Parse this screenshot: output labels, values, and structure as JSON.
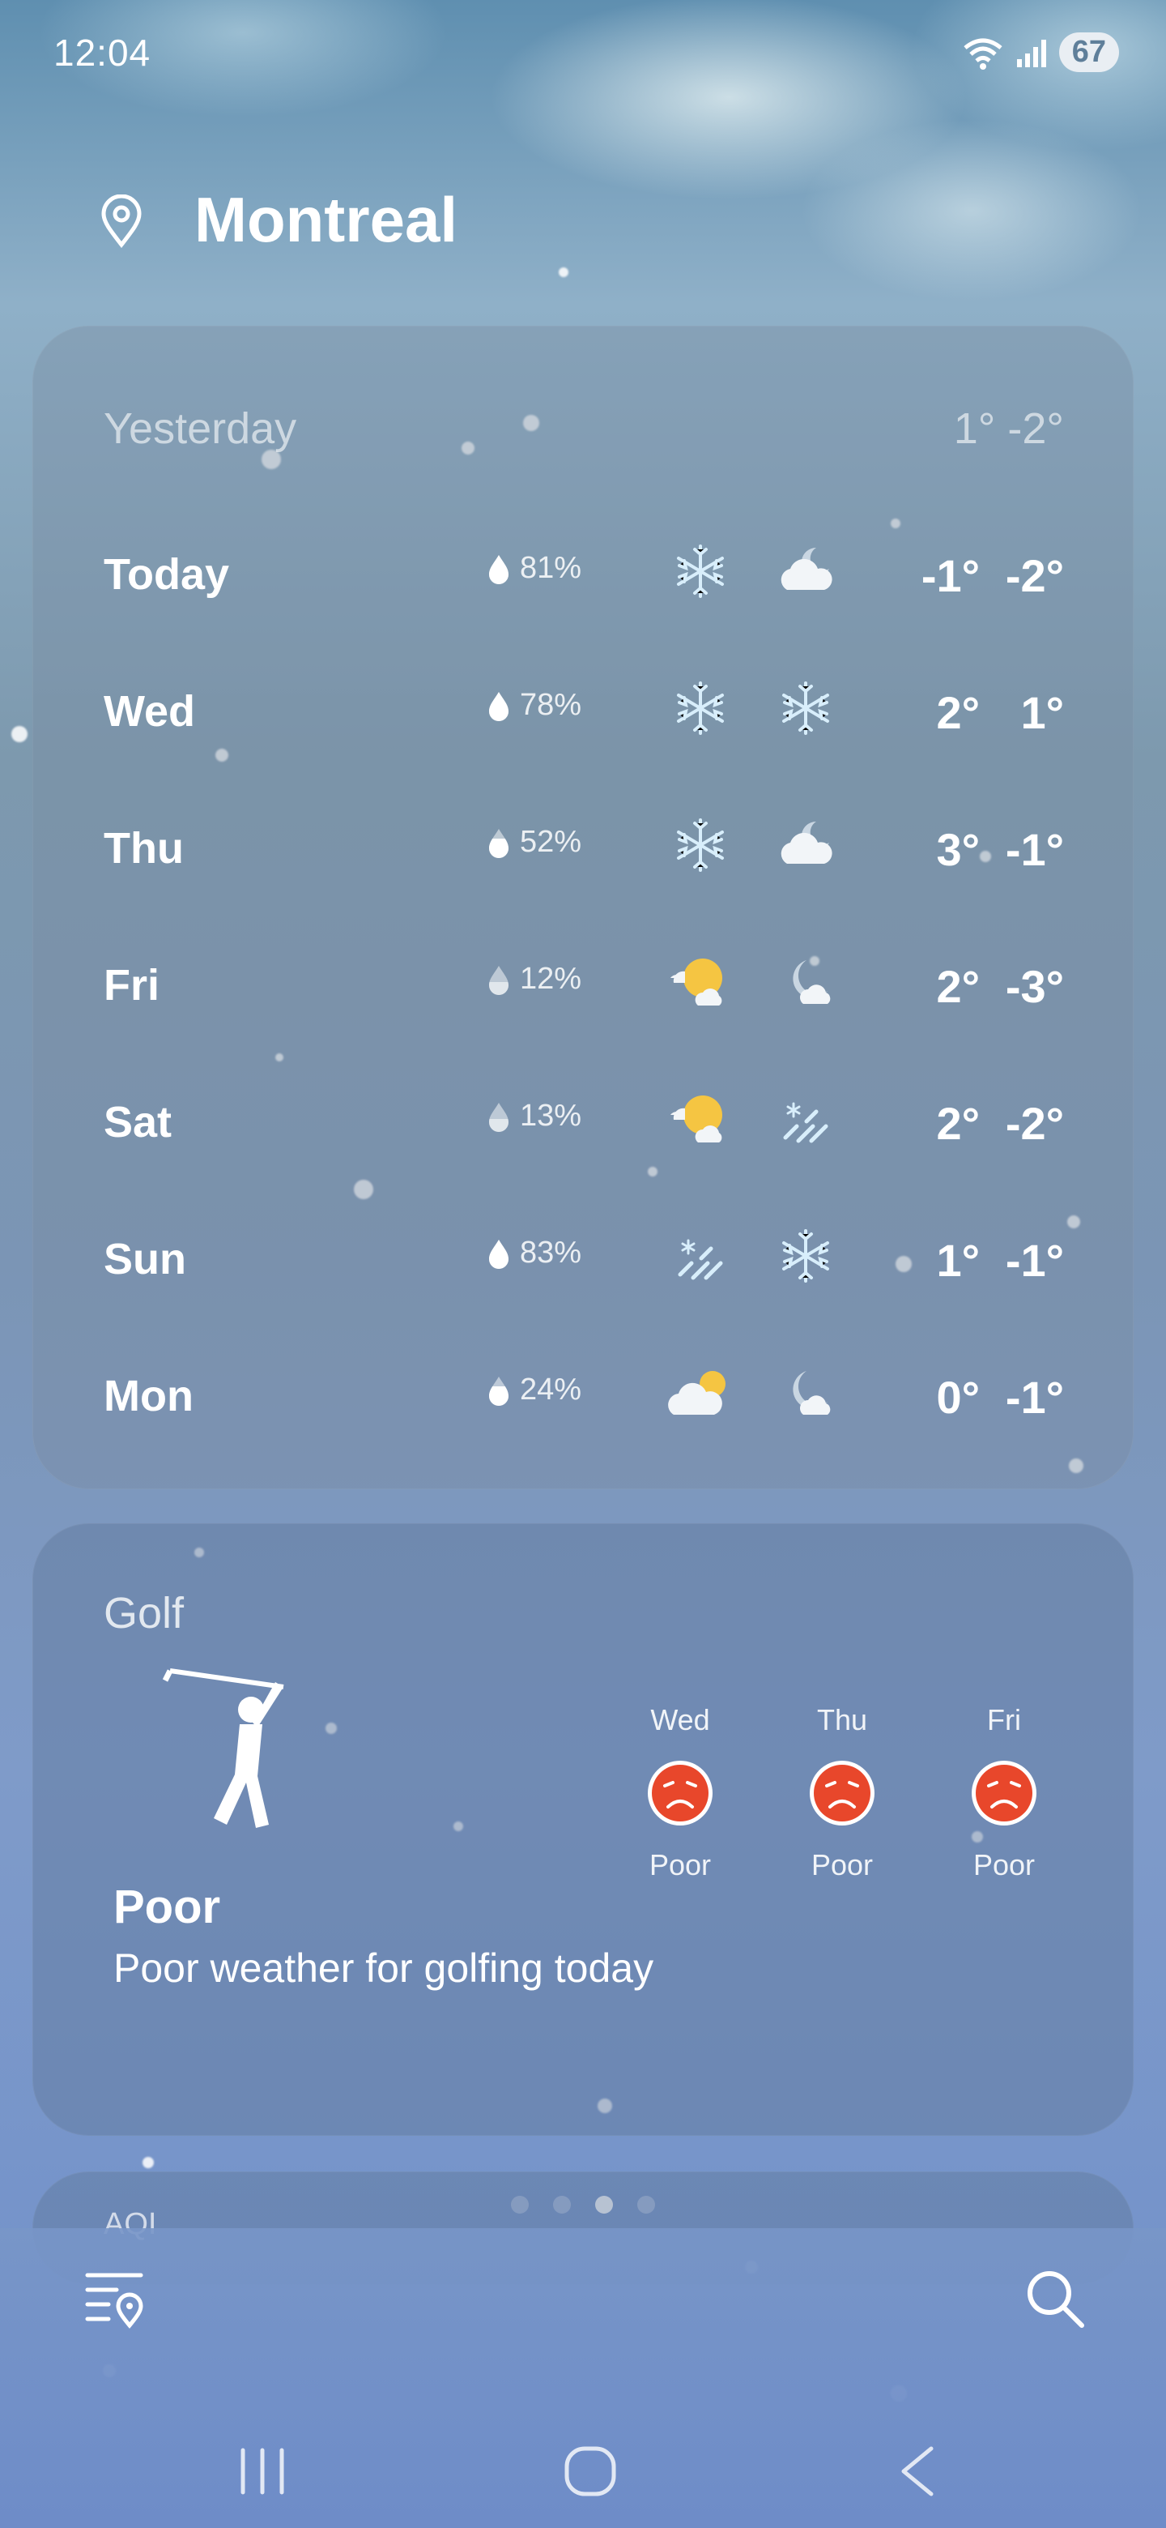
{
  "status_bar": {
    "time": "12:04",
    "battery": "67"
  },
  "header": {
    "city": "Montreal"
  },
  "forecast": {
    "yesterday": {
      "label": "Yesterday",
      "temps": "1° -2°"
    },
    "days": [
      {
        "day": "Today",
        "precip": "81%",
        "day_icon": "snowflake",
        "night_icon": "cloud-moon",
        "hi": "-1°",
        "lo": "-2°"
      },
      {
        "day": "Wed",
        "precip": "78%",
        "day_icon": "snowflake",
        "night_icon": "snowflake",
        "hi": "2°",
        "lo": "1°"
      },
      {
        "day": "Thu",
        "precip": "52%",
        "day_icon": "snowflake",
        "night_icon": "cloud-moon",
        "hi": "3°",
        "lo": "-1°"
      },
      {
        "day": "Fri",
        "precip": "12%",
        "day_icon": "sun-cloud",
        "night_icon": "moon-cloud",
        "hi": "2°",
        "lo": "-3°"
      },
      {
        "day": "Sat",
        "precip": "13%",
        "day_icon": "sun-cloud",
        "night_icon": "snow-rain",
        "hi": "2°",
        "lo": "-2°"
      },
      {
        "day": "Sun",
        "precip": "83%",
        "day_icon": "snow-rain",
        "night_icon": "snowflake",
        "hi": "1°",
        "lo": "-1°"
      },
      {
        "day": "Mon",
        "precip": "24%",
        "day_icon": "cloud-sun",
        "night_icon": "moon-cloud",
        "hi": "0°",
        "lo": "-1°"
      }
    ]
  },
  "golf": {
    "title": "Golf",
    "status": "Poor",
    "description": "Poor weather for golfing today",
    "days": [
      {
        "day": "Wed",
        "rating": "Poor"
      },
      {
        "day": "Thu",
        "rating": "Poor"
      },
      {
        "day": "Fri",
        "rating": "Poor"
      }
    ],
    "page_count": 4,
    "active_page": 3
  },
  "aqi": {
    "label": "AQI"
  },
  "colors": {
    "poor": "#e8472b",
    "sun": "#f5c542",
    "snow": "#d8eefb"
  }
}
